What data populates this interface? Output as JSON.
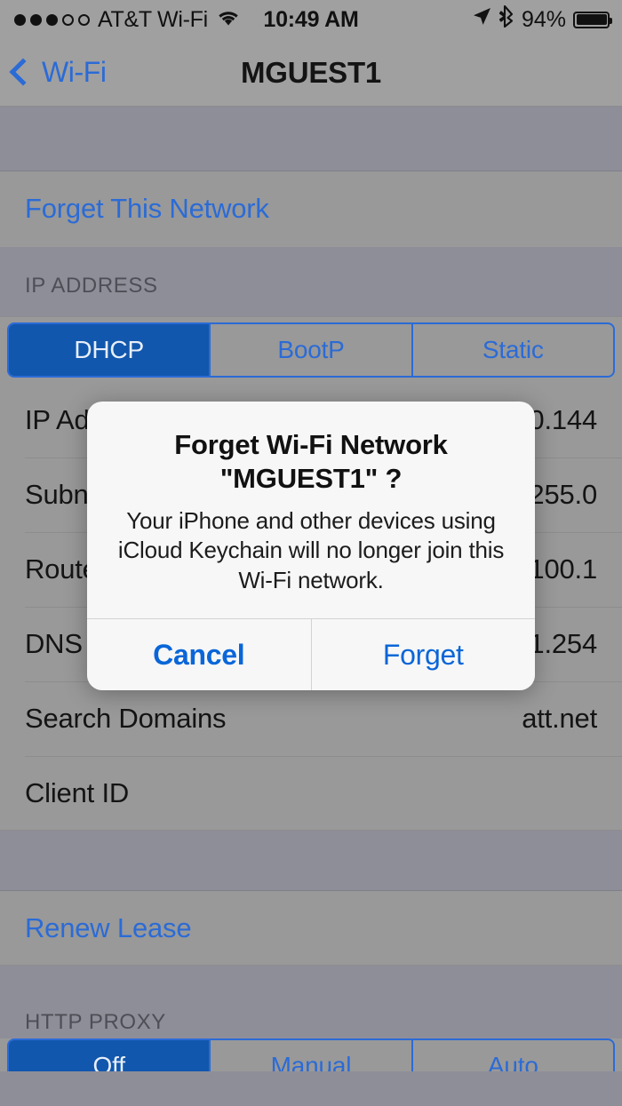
{
  "statusbar": {
    "signal_filled": 3,
    "signal_empty": 2,
    "carrier": "AT&T Wi-Fi",
    "wifi_icon": "wifi-icon",
    "time": "10:49 AM",
    "location_icon": "location-arrow-icon",
    "bluetooth_icon": "bluetooth-icon",
    "battery_percent": "94%"
  },
  "navbar": {
    "back_icon": "chevron-left-icon",
    "back_label": "Wi-Fi",
    "title": "MGUEST1"
  },
  "rows": {
    "forget_network": "Forget This Network",
    "renew_lease": "Renew Lease"
  },
  "sections": {
    "ip_address": "IP ADDRESS",
    "http_proxy": "HTTP PROXY"
  },
  "ip_segmented": {
    "options": [
      "DHCP",
      "BootP",
      "Static"
    ],
    "selected": "DHCP"
  },
  "proxy_segmented": {
    "options": [
      "Off",
      "Manual",
      "Auto"
    ],
    "selected": "Off"
  },
  "ip_details": [
    {
      "label": "IP Address",
      "value": "10.9.10.144"
    },
    {
      "label": "Subnet Mask",
      "value": "255.255.255.0"
    },
    {
      "label": "Router",
      "value": "10.9.100.1"
    },
    {
      "label": "DNS",
      "value": "10.9.1.254"
    },
    {
      "label": "Search Domains",
      "value": "att.net"
    },
    {
      "label": "Client ID",
      "value": ""
    }
  ],
  "alert": {
    "title": "Forget Wi-Fi Network\n\"MGUEST1\" ?",
    "message": "Your iPhone and other devices using\niCloud Keychain will no longer join this\nWi-Fi network.",
    "cancel_label": "Cancel",
    "confirm_label": "Forget"
  },
  "colors": {
    "accent_blue": "#2b6bd6",
    "alert_blue": "#0a66d8",
    "selected_segment": "#1157ad",
    "row_bg": "#999999",
    "group_bg": "#8e8e99"
  }
}
